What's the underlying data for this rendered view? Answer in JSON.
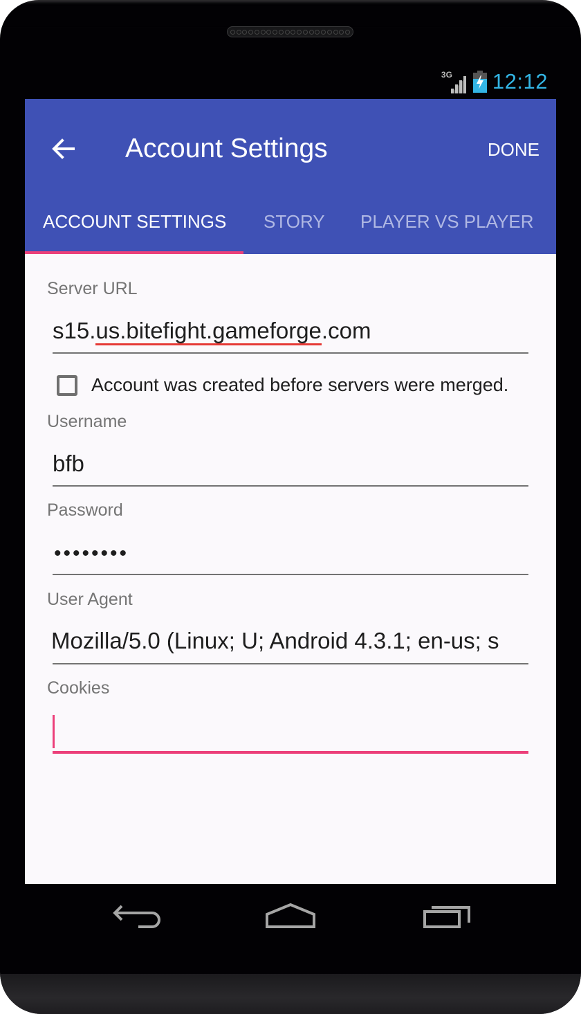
{
  "status_bar": {
    "network_label": "3G",
    "network_icon": "signal-icon",
    "battery_icon": "battery-charging-icon",
    "time": "12:12",
    "time_color": "#33b5e5"
  },
  "app_bar": {
    "back_icon": "arrow-left-icon",
    "title": "Account Settings",
    "done_label": "DONE",
    "color": "#3f51b5"
  },
  "tabs": [
    {
      "label": "ACCOUNT SETTINGS",
      "active": true
    },
    {
      "label": "STORY",
      "active": false
    },
    {
      "label": "PLAYER VS PLAYER",
      "active": false
    }
  ],
  "accent_color": "#ec407a",
  "form": {
    "server_url": {
      "label": "Server URL",
      "value_prefix": "s15.",
      "value_misspelled": "us.bitefight.gameforge",
      "value_suffix": ".com"
    },
    "merged_checkbox": {
      "label": "Account was created before servers were merged.",
      "checked": false
    },
    "username": {
      "label": "Username",
      "value": "bfb"
    },
    "password": {
      "label": "Password",
      "value": "••••••••"
    },
    "user_agent": {
      "label": "User Agent",
      "value": "Mozilla/5.0 (Linux; U; Android 4.3.1; en-us; s"
    },
    "cookies": {
      "label": "Cookies",
      "value": ""
    }
  },
  "nav_bar": {
    "back_icon": "nav-back-icon",
    "home_icon": "nav-home-icon",
    "recents_icon": "nav-recents-icon"
  }
}
